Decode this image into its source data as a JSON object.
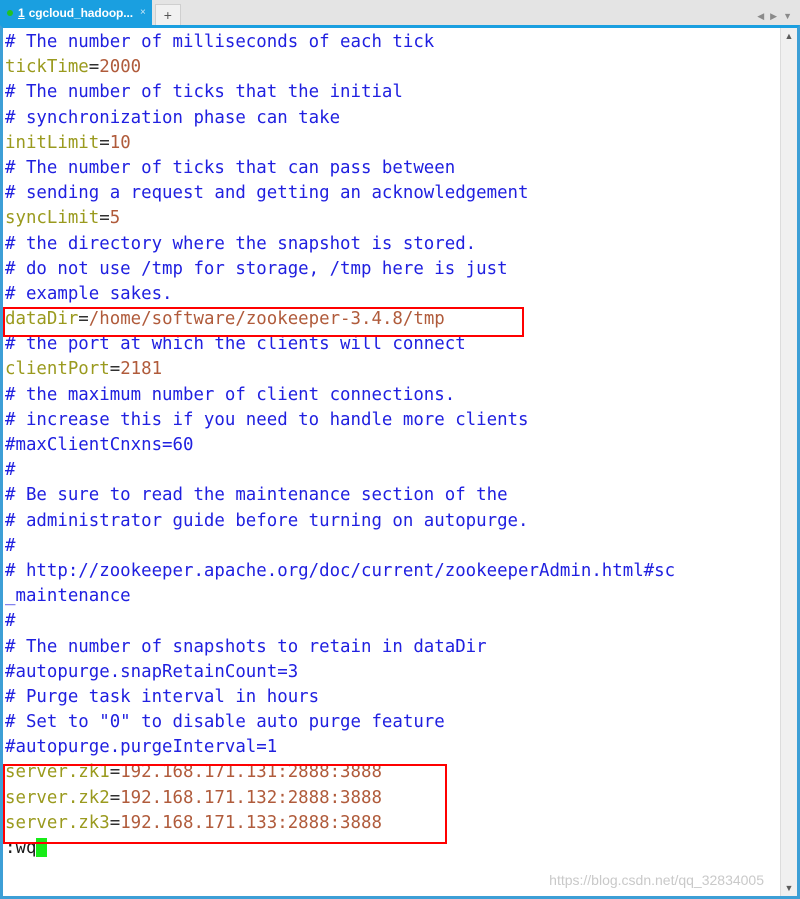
{
  "window": {
    "tab": {
      "status_dot": "connected",
      "index": "1",
      "title": "cgcloud_hadoop...",
      "close_label": "×"
    },
    "new_tab_label": "+",
    "controls": {
      "prev_label": "◀",
      "next_label": "▶",
      "menu_label": "▼"
    }
  },
  "scrollbar": {
    "up_arrow": "▲",
    "down_arrow": "▼"
  },
  "watermark": "https://blog.csdn.net/qq_32834005",
  "editor": {
    "mode_line": ":wq",
    "cursor": "block",
    "lines": [
      {
        "type": "comment",
        "text": "# The number of milliseconds of each tick"
      },
      {
        "type": "kv",
        "key": "tickTime",
        "eq": "=",
        "value": "2000"
      },
      {
        "type": "comment",
        "text": "# The number of ticks that the initial"
      },
      {
        "type": "comment",
        "text": "# synchronization phase can take"
      },
      {
        "type": "kv",
        "key": "initLimit",
        "eq": "=",
        "value": "10"
      },
      {
        "type": "comment",
        "text": "# The number of ticks that can pass between"
      },
      {
        "type": "comment",
        "text": "# sending a request and getting an acknowledgement"
      },
      {
        "type": "kv",
        "key": "syncLimit",
        "eq": "=",
        "value": "5"
      },
      {
        "type": "comment",
        "text": "# the directory where the snapshot is stored."
      },
      {
        "type": "comment",
        "text": "# do not use /tmp for storage, /tmp here is just"
      },
      {
        "type": "comment",
        "text": "# example sakes."
      },
      {
        "type": "kv",
        "key": "dataDir",
        "eq": "=",
        "value": "/home/software/zookeeper-3.4.8/tmp"
      },
      {
        "type": "comment",
        "text": "# the port at which the clients will connect"
      },
      {
        "type": "kv",
        "key": "clientPort",
        "eq": "=",
        "value": "2181"
      },
      {
        "type": "comment",
        "text": "# the maximum number of client connections."
      },
      {
        "type": "comment",
        "text": "# increase this if you need to handle more clients"
      },
      {
        "type": "comment",
        "text": "#maxClientCnxns=60"
      },
      {
        "type": "comment",
        "text": "#"
      },
      {
        "type": "comment",
        "text": "# Be sure to read the maintenance section of the"
      },
      {
        "type": "comment",
        "text": "# administrator guide before turning on autopurge."
      },
      {
        "type": "comment",
        "text": "#"
      },
      {
        "type": "comment",
        "text": "# http://zookeeper.apache.org/doc/current/zookeeperAdmin.html#sc"
      },
      {
        "type": "comment",
        "text": "_maintenance"
      },
      {
        "type": "comment",
        "text": "#"
      },
      {
        "type": "comment",
        "text": "# The number of snapshots to retain in dataDir"
      },
      {
        "type": "comment",
        "text": "#autopurge.snapRetainCount=3"
      },
      {
        "type": "comment",
        "text": "# Purge task interval in hours"
      },
      {
        "type": "comment",
        "text": "# Set to \"0\" to disable auto purge feature"
      },
      {
        "type": "comment",
        "text": "#autopurge.purgeInterval=1"
      },
      {
        "type": "kv",
        "key": "server.zk1",
        "eq": "=",
        "value": "192.168.171.131:2888:3888"
      },
      {
        "type": "kv",
        "key": "server.zk2",
        "eq": "=",
        "value": "192.168.171.132:2888:3888"
      },
      {
        "type": "kv",
        "key": "server.zk3",
        "eq": "=",
        "value": "192.168.171.133:2888:3888"
      }
    ]
  },
  "annotations": [
    {
      "name": "datadir-highlight",
      "color": "#ff0000",
      "target": "dataDir line"
    },
    {
      "name": "servers-highlight",
      "color": "#ff0000",
      "target": "server.zk1-zk3 lines"
    }
  ],
  "colors": {
    "accent": "#1a9fe0",
    "comment": "#2020e0",
    "key": "#9a9a1e",
    "value": "#b05b3b",
    "annotation": "#ff0000",
    "cursor": "#17ec17"
  }
}
